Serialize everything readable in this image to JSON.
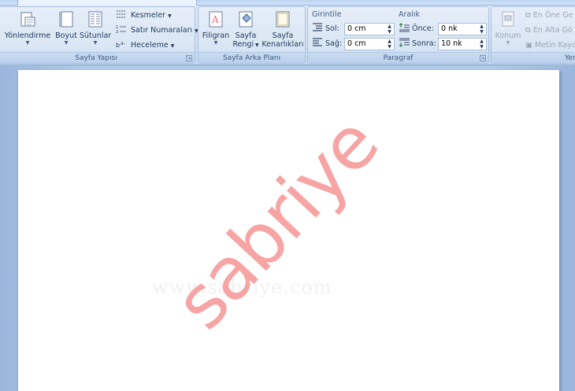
{
  "ribbon": {
    "page_setup": {
      "label": "Sayfa Yapısı",
      "orientation": "Yönlendirme",
      "size": "Boyut",
      "columns": "Sütunlar",
      "breaks": "Kesmeler",
      "line_numbers": "Satır Numaraları",
      "hyphenation": "Heceleme"
    },
    "page_background": {
      "label": "Sayfa Arka Planı",
      "watermark_line1": "Filigran",
      "page_color_line1": "Sayfa",
      "page_color_line2": "Rengi",
      "page_borders_line1": "Sayfa",
      "page_borders_line2": "Kenarlıkları"
    },
    "paragraph": {
      "label": "Paragraf",
      "indent_title": "Girintile",
      "left_label": "Sol:",
      "left_value": "0 cm",
      "right_label": "Sağ:",
      "right_value": "0 cm",
      "spacing_title": "Aralık",
      "before_label": "Önce:",
      "before_value": "0 nk",
      "after_label": "Sonra:",
      "after_value": "10 nk"
    },
    "arrange": {
      "label": "Yer",
      "position": "Konum",
      "bring_front": "En Öne Ge",
      "send_back": "En Alta Gö",
      "text_wrap": "Metin Kayd"
    }
  },
  "document": {
    "watermark_text": "sabriye",
    "faint_text": "www.sabriye.com",
    "watermark_color": "#f7a4a4"
  }
}
